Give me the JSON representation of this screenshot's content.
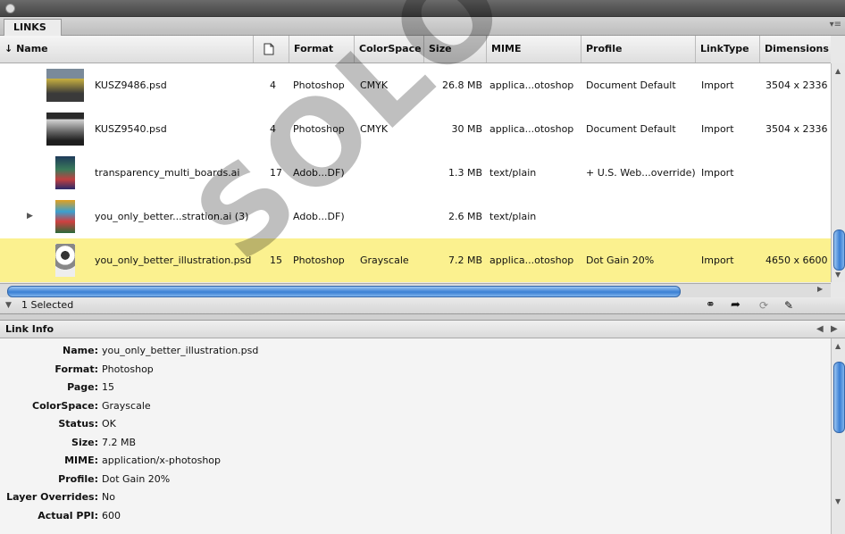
{
  "panel": {
    "tab_label": "LINKS",
    "menu_icon": "panel-menu-icon"
  },
  "columns": [
    {
      "label": "Name",
      "sort": "↓"
    },
    {
      "label": "",
      "icon": "page-icon"
    },
    {
      "label": "Format"
    },
    {
      "label": "ColorSpace"
    },
    {
      "label": "Size"
    },
    {
      "label": "MIME"
    },
    {
      "label": "Profile"
    },
    {
      "label": "LinkType"
    },
    {
      "label": "Dimensions"
    }
  ],
  "rows": [
    {
      "name": "KUSZ9486.psd",
      "page": "4",
      "format": "Photoshop",
      "colorspace": "CMYK",
      "size": "26.8 MB",
      "mime": "applica...otoshop",
      "profile": "Document Default",
      "linktype": "Import",
      "dimensions": "3504 x 2336",
      "selected": false,
      "expandable": false,
      "thumb_color": "#c8b040"
    },
    {
      "name": "KUSZ9540.psd",
      "page": "4",
      "format": "Photoshop",
      "colorspace": "CMYK",
      "size": "30 MB",
      "mime": "applica...otoshop",
      "profile": "Document Default",
      "linktype": "Import",
      "dimensions": "3504 x 2336",
      "selected": false,
      "expandable": false,
      "thumb_color": "#606060"
    },
    {
      "name": "transparency_multi_boards.ai",
      "page": "17",
      "format": "Adob...DF)",
      "colorspace": "",
      "size": "1.3 MB",
      "mime": "text/plain",
      "profile": "+ U.S. Web...override)",
      "linktype": "Import",
      "dimensions": "",
      "selected": false,
      "expandable": false,
      "thumb_color": "#3a7a5a"
    },
    {
      "name": "you_only_better...stration.ai (3)",
      "page": "",
      "format": "Adob...DF)",
      "colorspace": "",
      "size": "2.6 MB",
      "mime": "text/plain",
      "profile": "",
      "linktype": "",
      "dimensions": "",
      "selected": false,
      "expandable": true,
      "thumb_color": "#e0a020"
    },
    {
      "name": "you_only_better_illustration.psd",
      "page": "15",
      "format": "Photoshop",
      "colorspace": "Grayscale",
      "size": "7.2 MB",
      "mime": "applica...otoshop",
      "profile": "Dot Gain 20%",
      "linktype": "Import",
      "dimensions": "4650 x 6600",
      "selected": true,
      "expandable": false,
      "thumb_color": "#9a9a9a"
    }
  ],
  "status": {
    "selected_text": "1 Selected"
  },
  "link_info": {
    "title": "Link Info",
    "fields": [
      {
        "label": "Name:",
        "value": "you_only_better_illustration.psd"
      },
      {
        "label": "Format:",
        "value": "Photoshop"
      },
      {
        "label": "Page:",
        "value": "15"
      },
      {
        "label": "ColorSpace:",
        "value": "Grayscale"
      },
      {
        "label": "Status:",
        "value": "OK"
      },
      {
        "label": "Size:",
        "value": "7.2 MB"
      },
      {
        "label": "MIME:",
        "value": "application/x-photoshop"
      },
      {
        "label": "Profile:",
        "value": "Dot Gain 20%"
      },
      {
        "label": "Layer Overrides:",
        "value": "No"
      },
      {
        "label": "Actual PPI:",
        "value": "600"
      }
    ]
  },
  "watermark": "SOLO NET"
}
